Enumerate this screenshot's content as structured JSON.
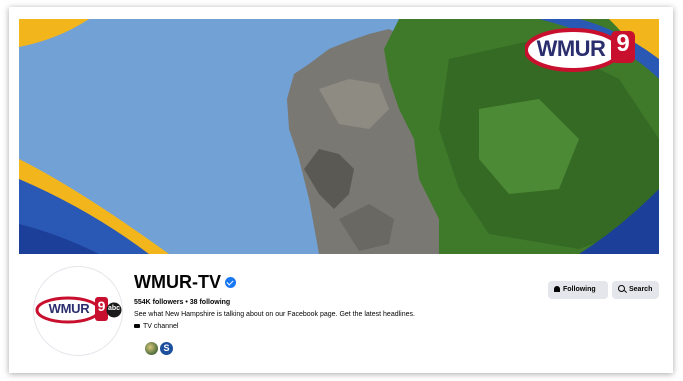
{
  "page": {
    "name": "WMUR-TV",
    "verified": true,
    "stats": "554K followers • 38 following",
    "description": "See what New Hampshire is talking about on our Facebook page. Get the latest headlines.",
    "category": "TV channel"
  },
  "cover": {
    "logo_text": "WMUR",
    "logo_number": "9"
  },
  "avatar": {
    "logo_text": "WMUR",
    "logo_number": "9",
    "network": "abc"
  },
  "actions": {
    "following_label": "Following",
    "search_label": "Search"
  },
  "mutual_followers": [
    {
      "icon": "landscape-avatar"
    },
    {
      "icon": "s-logo-avatar",
      "label": "S"
    }
  ],
  "colors": {
    "sky": "#6f9fd3",
    "accent_gold": "#f2b61c",
    "accent_blue": "#1c3f9a",
    "foliage": "#3f7a2b",
    "verified": "#1877f2",
    "button_bg": "#e4e6eb"
  }
}
